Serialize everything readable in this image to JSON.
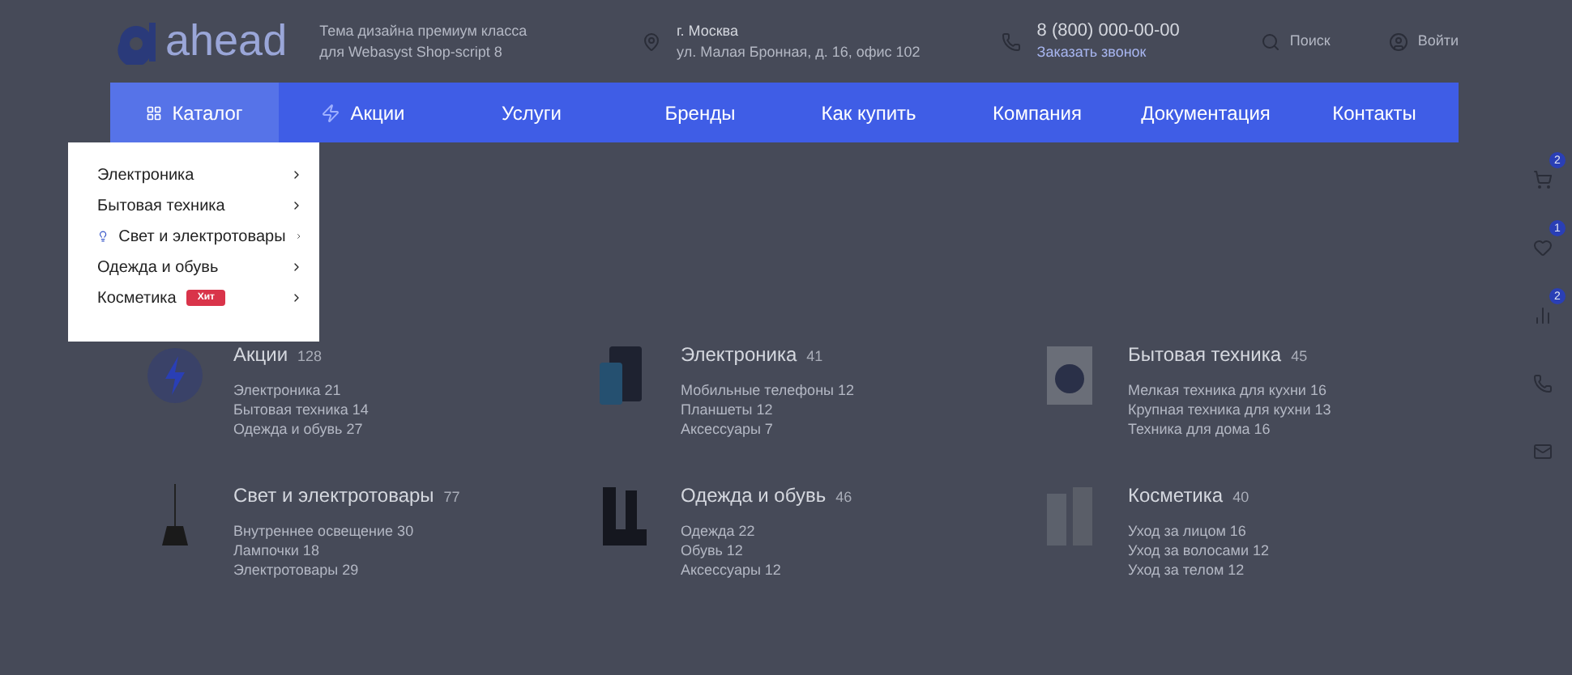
{
  "header": {
    "logo": "ahead",
    "tagline": "Тема дизайна премиум класса для Webasyst Shop-script 8",
    "city": "г. Москва",
    "address": "ул. Малая Бронная, д. 16, офис 102",
    "phone": "8 (800) 000-00-00",
    "callback": "Заказать звонок",
    "search": "Поиск",
    "login": "Войти"
  },
  "nav": [
    {
      "label": "Каталог",
      "kind": "catalog",
      "selected": true
    },
    {
      "label": "Акции",
      "kind": "promo",
      "selected": false
    },
    {
      "label": "Услуги",
      "kind": "plain",
      "selected": false
    },
    {
      "label": "Бренды",
      "kind": "plain",
      "selected": false
    },
    {
      "label": "Как купить",
      "kind": "plain",
      "selected": false
    },
    {
      "label": "Компания",
      "kind": "plain",
      "selected": false
    },
    {
      "label": "Документация",
      "kind": "plain",
      "selected": false
    },
    {
      "label": "Контакты",
      "kind": "plain",
      "selected": false
    }
  ],
  "dropdown": [
    {
      "label": "Электроника",
      "kind": "plain"
    },
    {
      "label": "Бытовая техника",
      "kind": "plain"
    },
    {
      "label": "Свет и электротовары",
      "kind": "icon"
    },
    {
      "label": "Одежда и обувь",
      "kind": "plain"
    },
    {
      "label": "Косметика",
      "kind": "plain",
      "badge": "Хит"
    }
  ],
  "categories": [
    {
      "title": "Акции",
      "count": "128",
      "kind": "promo",
      "links": [
        "Электроника 21",
        "Бытовая техника 14",
        "Одежда и обувь 27"
      ]
    },
    {
      "title": "Электроника",
      "count": "41",
      "kind": "tablet",
      "links": [
        "Мобильные телефоны 12",
        "Планшеты 12",
        "Аксессуары 7"
      ]
    },
    {
      "title": "Бытовая техника",
      "count": "45",
      "kind": "washer",
      "links": [
        "Мелкая техника для кухни 16",
        "Крупная техника для кухни 13",
        "Техника для дома 16"
      ]
    },
    {
      "title": "Свет и электротовары",
      "count": "77",
      "kind": "lamp",
      "links": [
        "Внутреннее освещение 30",
        "Лампочки 18",
        "Электротовары 29"
      ]
    },
    {
      "title": "Одежда и обувь",
      "count": "46",
      "kind": "boots",
      "links": [
        "Одежда 22",
        "Обувь 12",
        "Аксессуары 12"
      ]
    },
    {
      "title": "Косметика",
      "count": "40",
      "kind": "bottles",
      "links": [
        "Уход за лицом 16",
        "Уход за волосами 12",
        "Уход за телом 12"
      ]
    }
  ],
  "sidebar": [
    {
      "kind": "cart",
      "badge": "2"
    },
    {
      "kind": "heart",
      "badge": "1"
    },
    {
      "kind": "compare",
      "badge": "2"
    },
    {
      "kind": "phone"
    },
    {
      "kind": "mail"
    }
  ]
}
